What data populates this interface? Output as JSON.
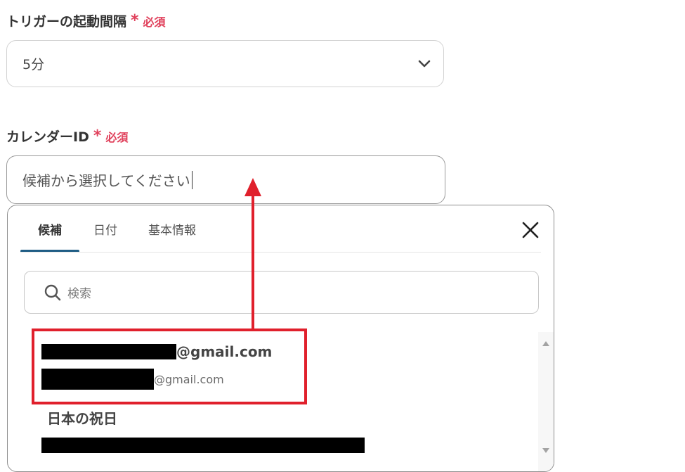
{
  "trigger_interval": {
    "label": "トリガーの起動間隔",
    "required_mark": "*",
    "required_text": "必須",
    "selected_value": "5分"
  },
  "calendar_id": {
    "label": "カレンダーID",
    "required_mark": "*",
    "required_text": "必須",
    "placeholder": "候補から選択してください"
  },
  "picker": {
    "tabs": [
      {
        "label": "候補",
        "active": true
      },
      {
        "label": "日付",
        "active": false
      },
      {
        "label": "基本情報",
        "active": false
      }
    ],
    "search_placeholder": "検索",
    "options": [
      {
        "title_suffix": "@gmail.com",
        "subtitle_suffix": "@gmail.com"
      },
      {
        "title": "日本の祝日"
      }
    ]
  },
  "annotation": {
    "highlight_color": "#e0202c"
  },
  "colors": {
    "required": "#e0405b",
    "tab_active_underline": "#1f5d85"
  }
}
